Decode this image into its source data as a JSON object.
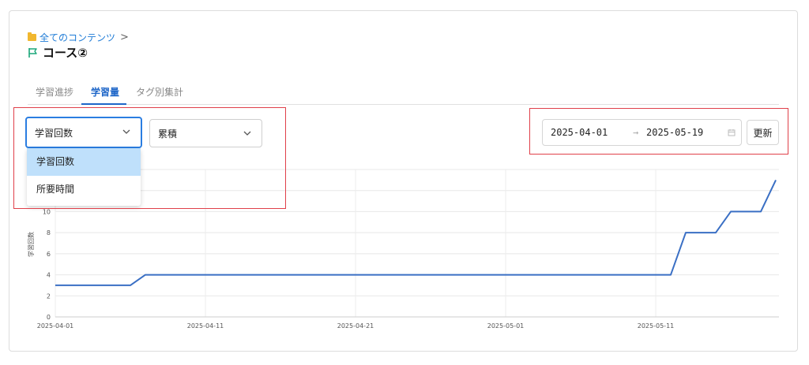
{
  "breadcrumb": {
    "label": "全てのコンテンツ",
    "separator": ">"
  },
  "page": {
    "title": "コース②"
  },
  "tabs": [
    {
      "label": "学習進捗",
      "active": false
    },
    {
      "label": "学習量",
      "active": true
    },
    {
      "label": "タグ別集計",
      "active": false
    }
  ],
  "controls": {
    "metric_select": {
      "value": "学習回数",
      "open": true
    },
    "metric_options": [
      "学習回数",
      "所要時間"
    ],
    "mode_select": {
      "value": "累積"
    },
    "date_range": {
      "start": "2025-04-01",
      "separator": "→",
      "end": "2025-05-19"
    },
    "update_button": "更新"
  },
  "colors": {
    "accent": "#1e66c8",
    "line": "#3a6fc4",
    "highlight": "#e0404a",
    "selected_option": "#bfe0fb"
  },
  "chart_data": {
    "type": "line",
    "ylabel": "学習回数",
    "xlabel": "",
    "x_ticks": [
      "2025-04-01",
      "2025-04-11",
      "2025-04-21",
      "2025-05-01",
      "2025-05-11"
    ],
    "y_ticks": [
      0,
      2,
      4,
      6,
      8,
      10
    ],
    "ylim": [
      0,
      14
    ],
    "grid": true,
    "series": [
      {
        "x": [
          "2025-04-01",
          "2025-04-06",
          "2025-04-07",
          "2025-05-12",
          "2025-05-13",
          "2025-05-15",
          "2025-05-16",
          "2025-05-18",
          "2025-05-19"
        ],
        "y": [
          3,
          3,
          4,
          4,
          8,
          8,
          10,
          10,
          13
        ]
      }
    ]
  }
}
